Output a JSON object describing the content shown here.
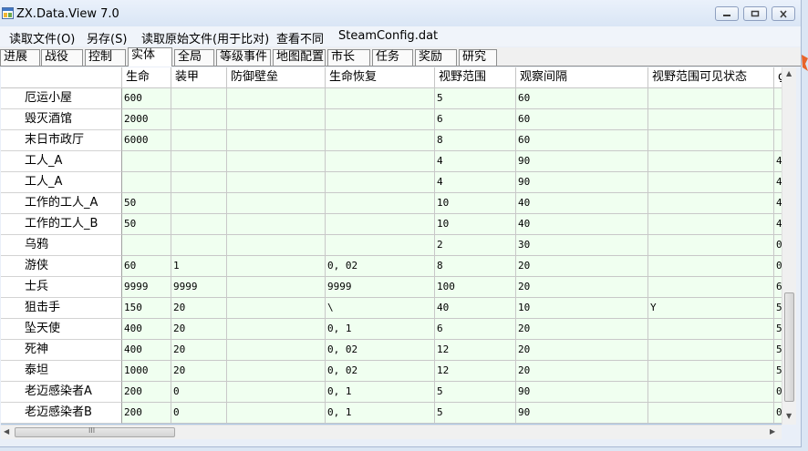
{
  "window": {
    "title": "ZX.Data.View 7.0",
    "minimize_icon": "minimize-icon",
    "maximize_icon": "maximize-icon",
    "close_icon": "close-icon"
  },
  "menu": [
    "读取文件(O)",
    "另存(S)",
    "读取原始文件(用于比对)",
    "查看不同",
    "SteamConfig.dat"
  ],
  "tabs": [
    "进展",
    "战役",
    "控制",
    "实体",
    "全局",
    "等级事件",
    "地图配置",
    "市长",
    "任务",
    "奖励",
    "研究"
  ],
  "active_tab": "实体",
  "grid": {
    "columns": [
      "生命",
      "装甲",
      "防御壁垒",
      "生命恢复",
      "视野范围",
      "观察间隔",
      "视野范围可见状态",
      "₫"
    ],
    "rows": [
      {
        "name": "厄运小屋",
        "cells": [
          "600",
          "",
          "",
          "",
          "5",
          "60",
          "",
          ""
        ]
      },
      {
        "name": "毁灭酒馆",
        "cells": [
          "2000",
          "",
          "",
          "",
          "6",
          "60",
          "",
          ""
        ]
      },
      {
        "name": "末日市政厅",
        "cells": [
          "6000",
          "",
          "",
          "",
          "8",
          "60",
          "",
          ""
        ]
      },
      {
        "name": "工人_A",
        "cells": [
          "",
          "",
          "",
          "",
          "4",
          "90",
          "",
          "4"
        ]
      },
      {
        "name": "工人_A",
        "cells": [
          "",
          "",
          "",
          "",
          "4",
          "90",
          "",
          "4"
        ]
      },
      {
        "name": "工作的工人_A",
        "cells": [
          "50",
          "",
          "",
          "",
          "10",
          "40",
          "",
          "4"
        ]
      },
      {
        "name": "工作的工人_B",
        "cells": [
          "50",
          "",
          "",
          "",
          "10",
          "40",
          "",
          "4"
        ]
      },
      {
        "name": "乌鸦",
        "cells": [
          "",
          "",
          "",
          "",
          "2",
          "30",
          "",
          "0"
        ]
      },
      {
        "name": "游侠",
        "cells": [
          "60",
          "1",
          "",
          "0, 02",
          "8",
          "20",
          "",
          "0"
        ]
      },
      {
        "name": "士兵",
        "cells": [
          "9999",
          "9999",
          "",
          "9999",
          "100",
          "20",
          "",
          "6"
        ]
      },
      {
        "name": "狙击手",
        "cells": [
          "150",
          "20",
          "",
          "\\",
          "40",
          "10",
          "Y",
          "5"
        ]
      },
      {
        "name": "坠天使",
        "cells": [
          "400",
          "20",
          "",
          "0, 1",
          "6",
          "20",
          "",
          "5"
        ]
      },
      {
        "name": "死神",
        "cells": [
          "400",
          "20",
          "",
          "0, 02",
          "12",
          "20",
          "",
          "5"
        ]
      },
      {
        "name": "泰坦",
        "cells": [
          "1000",
          "20",
          "",
          "0, 02",
          "12",
          "20",
          "",
          "5"
        ]
      },
      {
        "name": "老迈感染者A",
        "cells": [
          "200",
          "0",
          "",
          "0, 1",
          "5",
          "90",
          "",
          "0"
        ]
      },
      {
        "name": "老迈感染者B",
        "cells": [
          "200",
          "0",
          "",
          "0, 1",
          "5",
          "90",
          "",
          "0"
        ]
      }
    ]
  },
  "scroll": {
    "up_icon": "▲",
    "down_icon": "▼",
    "left_icon": "◀",
    "right_icon": "▶",
    "h_grip": "III"
  }
}
